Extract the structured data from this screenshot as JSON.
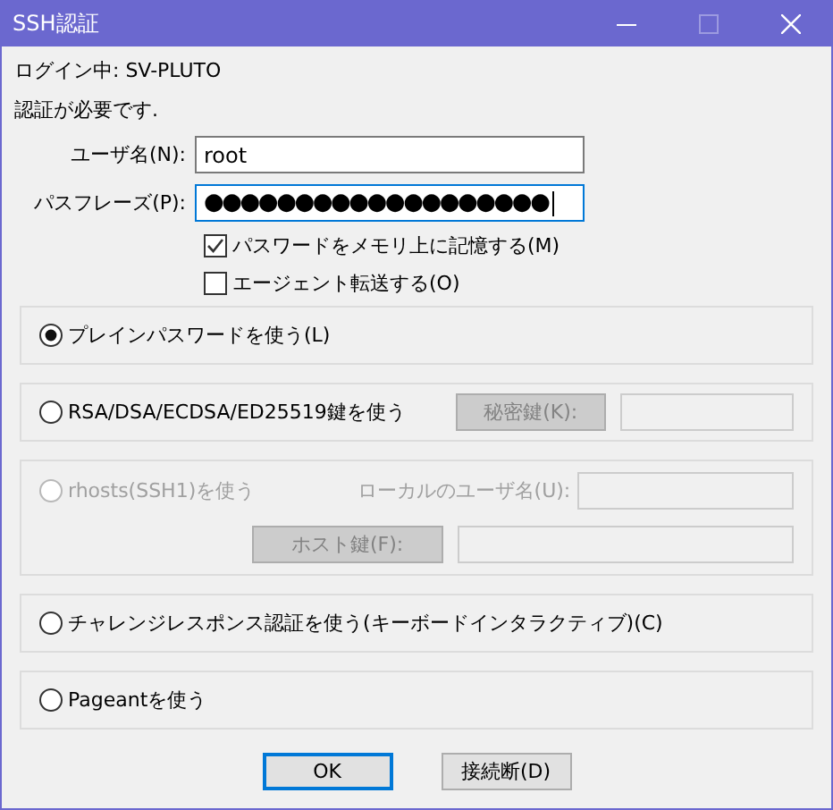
{
  "window": {
    "title": "SSH認証"
  },
  "login_line": "ログイン中: SV-PLUTO",
  "notice": "認証が必要です.",
  "fields": [
    {
      "label": "ユーザ名(N):",
      "value": "root",
      "focused": false
    },
    {
      "label": "パスフレーズ(P):",
      "value": "●●●●●●●●●●●●●●●●●●●",
      "focused": true
    }
  ],
  "checkboxes": [
    {
      "label": "パスワードをメモリ上に記憶する(M)",
      "checked": true
    },
    {
      "label": "エージェント転送する(O)",
      "checked": false
    }
  ],
  "methods": [
    {
      "kind": "plain",
      "label": "プレインパスワードを使う(L)",
      "selected": true,
      "disabled": false
    },
    {
      "kind": "key",
      "label": "RSA/DSA/ECDSA/ED25519鍵を使う",
      "selected": false,
      "disabled": false,
      "key_button": {
        "label": "秘密鍵(K):",
        "disabled": true
      }
    },
    {
      "kind": "rhosts",
      "label": "rhosts(SSH1)を使う",
      "selected": false,
      "disabled": true,
      "user_label": "ローカルのユーザ名(U):",
      "host_button": {
        "label": "ホスト鍵(F):",
        "disabled": true
      }
    },
    {
      "kind": "plain",
      "label": "チャレンジレスポンス認証を使う(キーボードインタラクティブ)(C)",
      "selected": false,
      "disabled": false
    },
    {
      "kind": "plain",
      "label": "Pageantを使う",
      "selected": false,
      "disabled": false
    }
  ],
  "buttons": [
    {
      "label": "OK",
      "default": true
    },
    {
      "label": "接続断(D)",
      "default": false
    }
  ]
}
